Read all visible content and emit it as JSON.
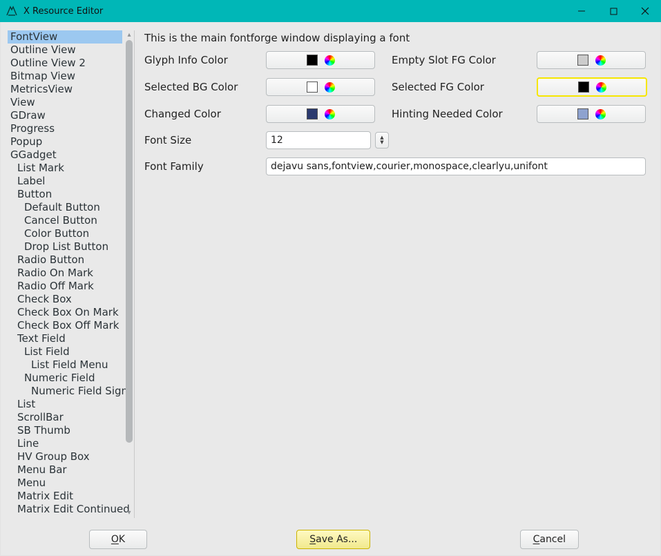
{
  "titlebar": {
    "title": "X Resource Editor",
    "min_tooltip": "Minimize",
    "max_tooltip": "Maximize",
    "close_tooltip": "Close"
  },
  "sidebar": {
    "items": [
      {
        "label": "FontView",
        "indent": 0,
        "selected": true
      },
      {
        "label": "Outline View",
        "indent": 0
      },
      {
        "label": "Outline View 2",
        "indent": 0
      },
      {
        "label": "Bitmap View",
        "indent": 0
      },
      {
        "label": "MetricsView",
        "indent": 0
      },
      {
        "label": "View",
        "indent": 0
      },
      {
        "label": "GDraw",
        "indent": 0
      },
      {
        "label": "Progress",
        "indent": 0
      },
      {
        "label": "Popup",
        "indent": 0
      },
      {
        "label": "GGadget",
        "indent": 0
      },
      {
        "label": "List Mark",
        "indent": 1
      },
      {
        "label": "Label",
        "indent": 1
      },
      {
        "label": "Button",
        "indent": 1
      },
      {
        "label": "Default Button",
        "indent": 2
      },
      {
        "label": "Cancel Button",
        "indent": 2
      },
      {
        "label": "Color Button",
        "indent": 2
      },
      {
        "label": "Drop List Button",
        "indent": 2
      },
      {
        "label": "Radio Button",
        "indent": 1
      },
      {
        "label": "Radio On Mark",
        "indent": 1
      },
      {
        "label": "Radio Off Mark",
        "indent": 1
      },
      {
        "label": "Check Box",
        "indent": 1
      },
      {
        "label": "Check Box On Mark",
        "indent": 1
      },
      {
        "label": "Check Box Off Mark",
        "indent": 1
      },
      {
        "label": "Text Field",
        "indent": 1
      },
      {
        "label": "List Field",
        "indent": 2
      },
      {
        "label": "List Field Menu",
        "indent": 3
      },
      {
        "label": "Numeric Field",
        "indent": 2
      },
      {
        "label": "Numeric Field Sign",
        "indent": 3
      },
      {
        "label": "List",
        "indent": 1
      },
      {
        "label": "ScrollBar",
        "indent": 1
      },
      {
        "label": "SB Thumb",
        "indent": 1
      },
      {
        "label": "Line",
        "indent": 1
      },
      {
        "label": "HV Group Box",
        "indent": 1
      },
      {
        "label": "Menu Bar",
        "indent": 1
      },
      {
        "label": "Menu",
        "indent": 1
      },
      {
        "label": "Matrix Edit",
        "indent": 1
      },
      {
        "label": "Matrix Edit Continued",
        "indent": 1
      }
    ]
  },
  "panel": {
    "description": "This is the main fontforge window displaying a font",
    "rows": [
      {
        "left_label": "Glyph Info Color",
        "left_swatch": "#000000",
        "right_label": "Empty Slot FG Color",
        "right_swatch": "#cccccc",
        "right_highlight": false
      },
      {
        "left_label": "Selected BG Color",
        "left_swatch": "#ffffff",
        "right_label": "Selected FG Color",
        "right_swatch": "#000000",
        "right_highlight": true
      },
      {
        "left_label": "Changed Color",
        "left_swatch": "#2b3a6e",
        "right_label": "Hinting Needed Color",
        "right_swatch": "#8ea2cf",
        "right_highlight": false
      }
    ],
    "font_size_label": "Font Size",
    "font_size_value": "12",
    "font_family_label": "Font Family",
    "font_family_value": "dejavu sans,fontview,courier,monospace,clearlyu,unifont"
  },
  "buttons": {
    "ok_label_u": "O",
    "ok_label_rest": "K",
    "save_label_u": "S",
    "save_label_rest": "ave As...",
    "cancel_label_u": "C",
    "cancel_label_rest": "ancel"
  }
}
